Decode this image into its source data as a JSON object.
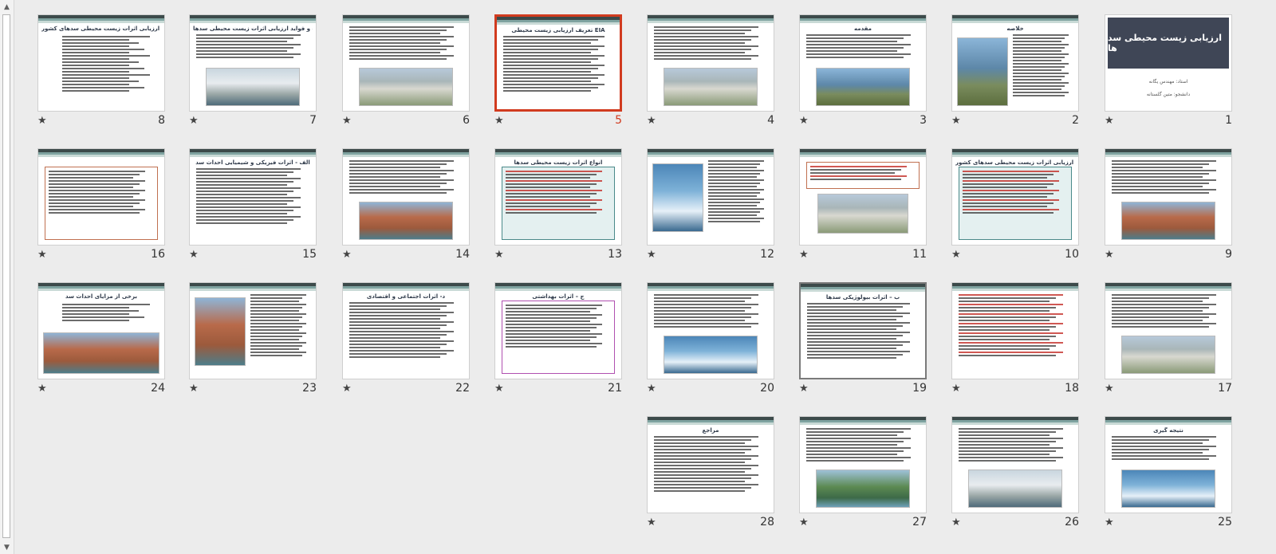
{
  "view": "slide-sorter",
  "selected_slide": 5,
  "hovered_slide": 19,
  "scrollbar": {
    "up_icon": "triangle-up",
    "down_icon": "triangle-down"
  },
  "slides": [
    {
      "number": "1",
      "title": "ارزیابی زیست محیطی سد ها",
      "lines": [
        "استاد: مهندس یگانه",
        "دانشجو: متین گلستانه"
      ]
    },
    {
      "number": "2",
      "title": "خلاصه"
    },
    {
      "number": "3",
      "title": "مقدمه"
    },
    {
      "number": "4",
      "title": ""
    },
    {
      "number": "5",
      "title": "تعریف ارزیابی زیست محیطی EIA"
    },
    {
      "number": "6",
      "title": ""
    },
    {
      "number": "7",
      "title": "اهداف ، ضرورت و فواید ارزیابی اثرات زیست محیطی سدها"
    },
    {
      "number": "8",
      "title": "محدودیتهای ارزیابی اثرات زیست محیطی سدهای کشور"
    },
    {
      "number": "9",
      "title": ""
    },
    {
      "number": "10",
      "title": "مشکلات ارزیابی اثرات زیست محیطی سدهای کشور"
    },
    {
      "number": "11",
      "title": ""
    },
    {
      "number": "12",
      "title": ""
    },
    {
      "number": "13",
      "title": "انواع اثرات زیست محیطی سدها"
    },
    {
      "number": "14",
      "title": ""
    },
    {
      "number": "15",
      "title": "الف - اثرات فیزیکی و شیمیایی احداث سد"
    },
    {
      "number": "16",
      "title": ""
    },
    {
      "number": "17",
      "title": ""
    },
    {
      "number": "18",
      "title": ""
    },
    {
      "number": "19",
      "title": "ب – اثرات بیولوژیکی سدها"
    },
    {
      "number": "20",
      "title": ""
    },
    {
      "number": "21",
      "title": "ج – اثرات بهداشتی"
    },
    {
      "number": "22",
      "title": "د- اثرات اجتماعی و اقتصادی"
    },
    {
      "number": "23",
      "title": ""
    },
    {
      "number": "24",
      "title": "برخی از مزایای احداث سد"
    },
    {
      "number": "25",
      "title": "نتیجه گیری"
    },
    {
      "number": "26",
      "title": ""
    },
    {
      "number": "27",
      "title": ""
    },
    {
      "number": "28",
      "title": "مراجع"
    }
  ],
  "star_icon": "★"
}
